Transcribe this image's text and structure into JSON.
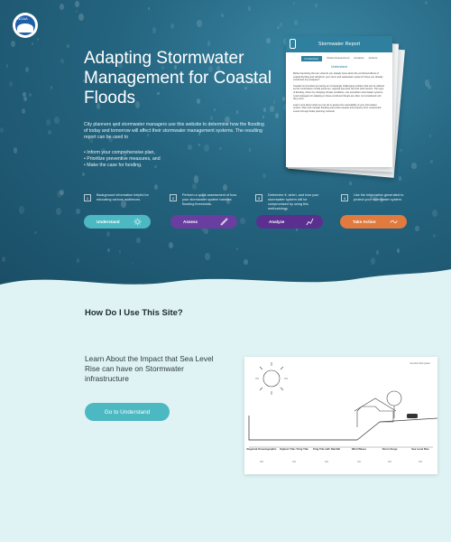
{
  "logo": {
    "text": "NOAA"
  },
  "hero": {
    "title": "Adapting Stormwater Management for Coastal Floods",
    "intro": "City planners and stormwater managers use this website to determine how the flooding of today and tomorrow will affect their stormwater management systems. The resulting report can be used to",
    "bullets": [
      "Inform your comprehensive plan,",
      "Prioritize preventive measures, and",
      "Make the case for funding."
    ]
  },
  "report": {
    "header": "Stormwater Report",
    "tabs": [
      "Introduction",
      "Model Assessment",
      "Analysis",
      "Actions"
    ],
    "subtitle": "Understand",
    "paragraphs": [
      "Before launching the tool, what do you already know about the combined effects of coastal flooding and rainfall on your storm and wastewater systems? Have you already conducted any analyses?",
      "Coastal communities are facing an increasingly challenging problem that can be defined as the combination of tidal extremes, regional sea level rise and other factors. This type of flooding, driven by changing climate conditions, can overwhelm stormwater systems. Local strategies for adapting to these combined threats are often not considered until they occur.",
      "Learn more about what you can do to assess the vulnerability of your stormwater system. Plan and manage flooding and protect people and property from unexpected events through better planning methods."
    ]
  },
  "steps": [
    {
      "num": "1",
      "text": "Background information helpful for educating various audiences.",
      "label": "Understand",
      "color": "#4cb8c2",
      "icon": "sun-icon"
    },
    {
      "num": "2",
      "text": "Perform a quick assessment of how your stormwater system handles flooding thresholds.",
      "label": "Assess",
      "color": "#6a3ea1",
      "icon": "ruler-icon"
    },
    {
      "num": "3",
      "text": "Determine if, when, and how your stormwater system will be compromised by using this methodology.",
      "label": "Analyze",
      "color": "#5a2f8f",
      "icon": "chart-icon"
    },
    {
      "num": "4",
      "text": "Use the information generated to protect your stormwater system.",
      "label": "Take Action",
      "color": "#e07a3f",
      "icon": "wave-icon"
    }
  ],
  "lower": {
    "title": "How Do I Use This Site?",
    "text": "Learn About the Impact that Sea Level Rise can have on Stormwater infrastructure",
    "button": "Go to Understand"
  },
  "diagram": {
    "control": "Control this pane",
    "labels": [
      {
        "title": "Regional Oceanographic",
        "value": "0 ft"
      },
      {
        "title": "Highest Tide / King Tide",
        "value": "0 ft"
      },
      {
        "title": "King Tide with Rainfall",
        "value": "0 ft"
      },
      {
        "title": "Wind Waves",
        "value": "0 ft"
      },
      {
        "title": "Storm Surge",
        "value": "0 ft"
      },
      {
        "title": "Sea Level Rise",
        "value": "0 ft"
      }
    ]
  }
}
